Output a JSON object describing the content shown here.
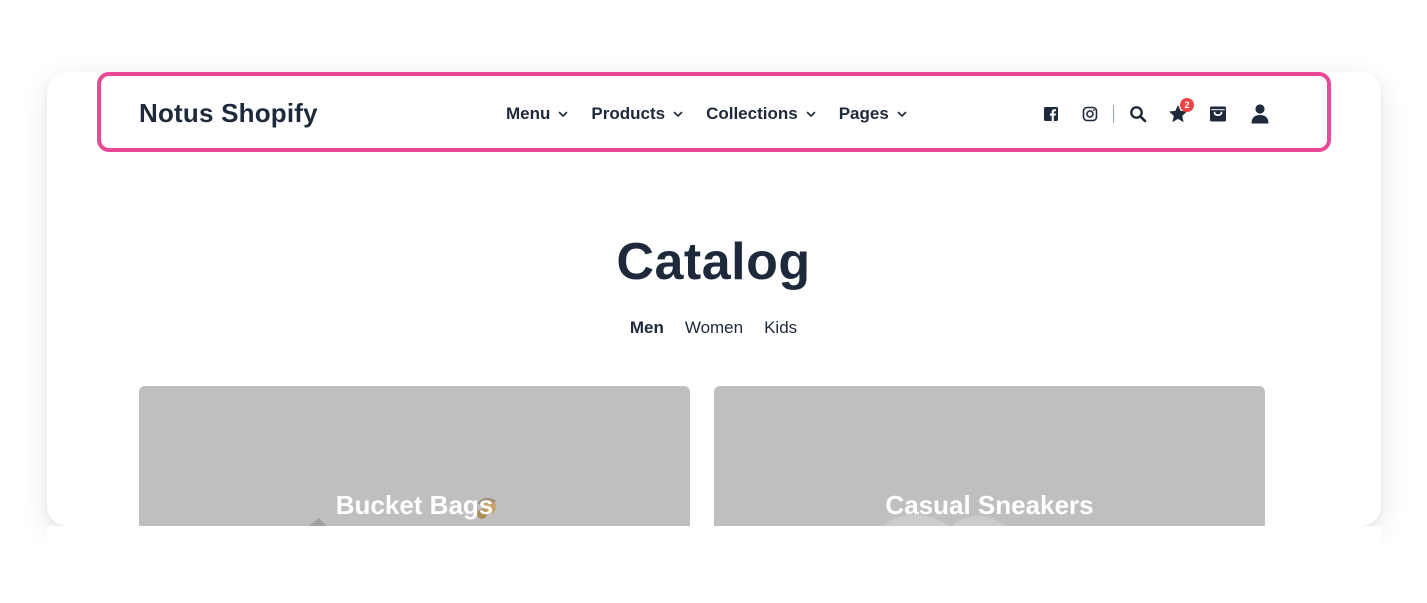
{
  "header": {
    "brand": "Notus Shopify",
    "nav": [
      {
        "label": "Menu"
      },
      {
        "label": "Products"
      },
      {
        "label": "Collections"
      },
      {
        "label": "Pages"
      }
    ],
    "icons": {
      "facebook": "facebook-icon",
      "instagram": "instagram-icon",
      "search": "search-icon",
      "wishlist": "star-icon",
      "cart": "shopping-bag-icon",
      "account": "user-icon"
    },
    "wishlist_count": "2"
  },
  "catalog": {
    "title": "Catalog",
    "tabs": [
      {
        "label": "Men",
        "active": true
      },
      {
        "label": "Women",
        "active": false
      },
      {
        "label": "Kids",
        "active": false
      }
    ],
    "tiles": [
      {
        "label": "Bucket Bags"
      },
      {
        "label": "Casual Sneakers"
      }
    ]
  },
  "colors": {
    "text": "#1e293b",
    "highlight": "#ec4899",
    "badge": "#ef4444",
    "tile_bg": "#bfbfbf"
  }
}
